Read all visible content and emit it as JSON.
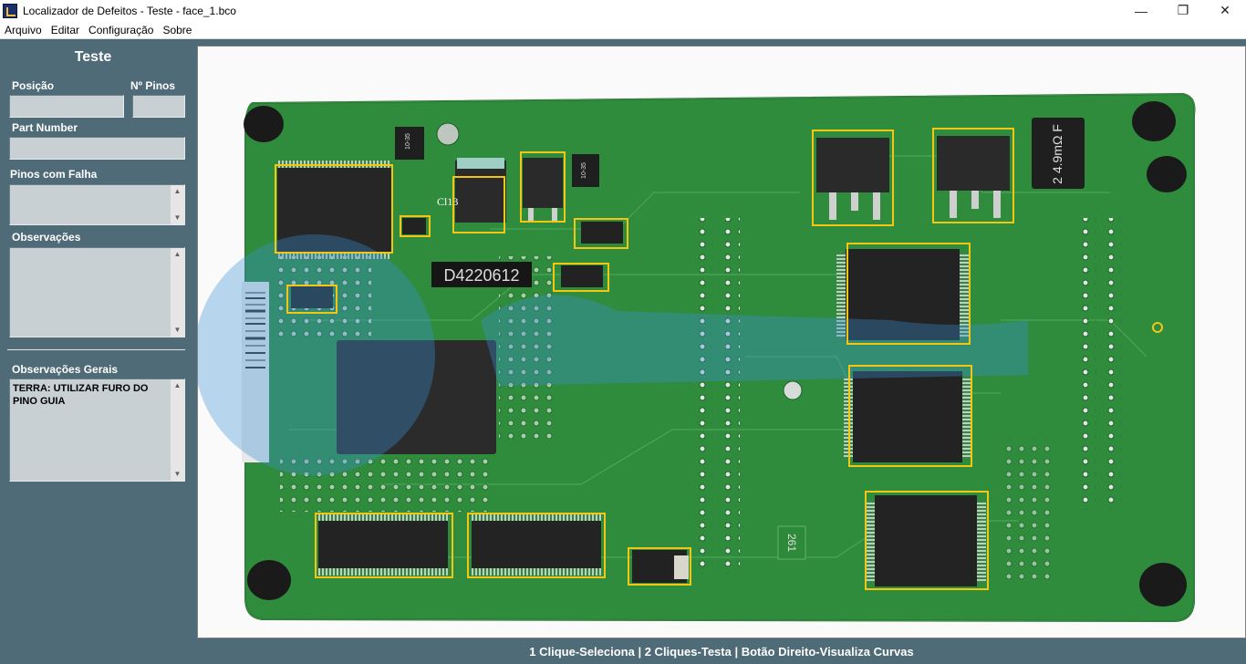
{
  "window": {
    "title": "Localizador de Defeitos - Teste - face_1.bco"
  },
  "menu": [
    "Arquivo",
    "Editar",
    "Configuração",
    "Sobre"
  ],
  "sidebar": {
    "title": "Teste",
    "posicao_label": "Posição",
    "posicao_value": "",
    "npinos_label": "Nº Pinos",
    "npinos_value": "",
    "partnumber_label": "Part Number",
    "partnumber_value": "",
    "pinos_falha_label": "Pinos com Falha",
    "pinos_falha_value": "",
    "observacoes_label": "Observações",
    "observacoes_value": "",
    "obs_gerais_label": "Observações Gerais",
    "obs_gerais_value": "TERRA: UTILIZAR FURO DO PINO GUIA"
  },
  "board": {
    "labels": {
      "cl3": "Cl13",
      "d4220612": "D4220612",
      "res": "2 4.9mΩ F",
      "u35a": "10-35",
      "u35b": "10-35",
      "n261": "261"
    }
  },
  "colors": {
    "background": "#4f6b77",
    "highlight": "#f3c614",
    "pcb": "#2f8c3c"
  },
  "status": {
    "text": "1 Clique-Seleciona | 2 Cliques-Testa | Botão Direito-Visualiza Curvas"
  }
}
